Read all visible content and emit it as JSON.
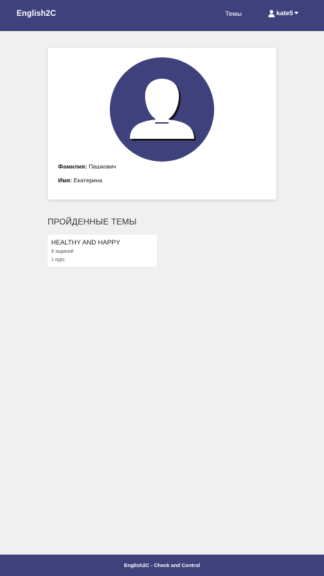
{
  "header": {
    "brand": "English2C",
    "nav_topics": "Темы",
    "username": "kate5",
    "user_icon": "user-icon",
    "dropdown_icon": "caret-down-icon"
  },
  "profile": {
    "avatar_icon": "user-silhouette-icon",
    "surname_label": "Фамилия:",
    "surname_value": "Пашкович",
    "name_label": "Имя:",
    "name_value": "Екатерина"
  },
  "completed_section": {
    "title": "ПРОЙДЕННЫЕ ТЕМЫ",
    "topics": [
      {
        "title": "HEALTHY AND HAPPY",
        "tasks": "9 заданий",
        "course": "1 курс"
      }
    ]
  },
  "footer": {
    "text": "English2C - Check and Control"
  },
  "colors": {
    "primary": "#3f417c",
    "background": "#f0f0f0",
    "card": "#ffffff"
  }
}
